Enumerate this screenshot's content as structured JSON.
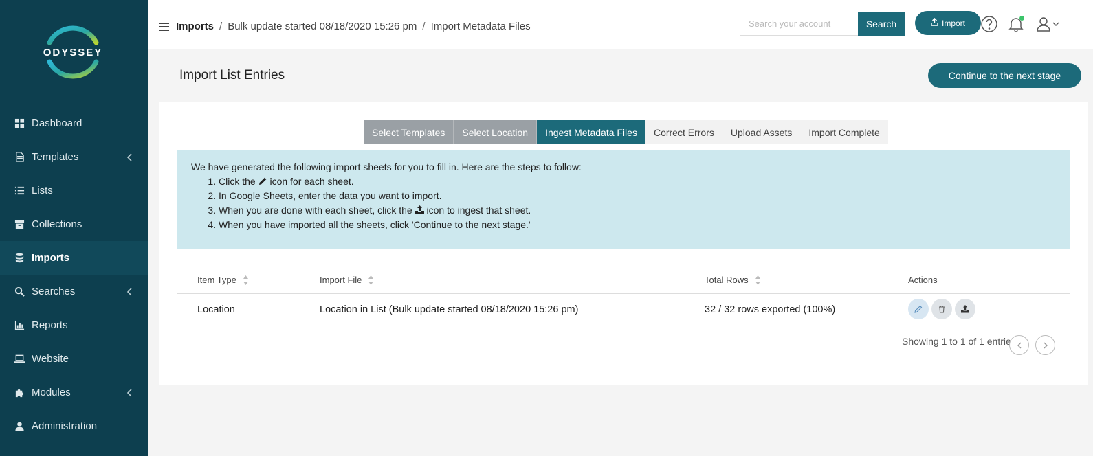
{
  "app": {
    "name": "ODYSSEY"
  },
  "sidebar": {
    "items": [
      {
        "label": "Dashboard",
        "icon": "dashboard-icon"
      },
      {
        "label": "Templates",
        "icon": "document-icon",
        "has_submenu": true
      },
      {
        "label": "Lists",
        "icon": "list-icon"
      },
      {
        "label": "Collections",
        "icon": "archive-icon"
      },
      {
        "label": "Imports",
        "icon": "database-icon",
        "active": true
      },
      {
        "label": "Searches",
        "icon": "search-icon",
        "has_submenu": true
      },
      {
        "label": "Reports",
        "icon": "bar-chart-icon"
      },
      {
        "label": "Website",
        "icon": "laptop-icon"
      },
      {
        "label": "Modules",
        "icon": "puzzle-icon",
        "has_submenu": true
      },
      {
        "label": "Administration",
        "icon": "user-icon"
      }
    ]
  },
  "header": {
    "breadcrumb": [
      "Imports",
      "Bulk update started 08/18/2020 15:26 pm",
      "Import Metadata Files"
    ],
    "search_placeholder": "Search your account",
    "search_label": "Search",
    "import_label": "Import"
  },
  "page": {
    "title": "Import List Entries",
    "continue_label": "Continue to the next stage"
  },
  "steps": [
    {
      "label": "Select Templates",
      "state": "done"
    },
    {
      "label": "Select Location",
      "state": "done"
    },
    {
      "label": "Ingest Metadata Files",
      "state": "current"
    },
    {
      "label": "Correct Errors",
      "state": "todo"
    },
    {
      "label": "Upload Assets",
      "state": "todo"
    },
    {
      "label": "Import Complete",
      "state": "todo"
    }
  ],
  "instructions": {
    "intro": "We have generated the following import sheets for you to fill in. Here are the steps to follow:",
    "step1_pre": "Click the",
    "step1_post": "icon for each sheet.",
    "step2": "In Google Sheets, enter the data you want to import.",
    "step3_pre": "When you are done with each sheet, click the",
    "step3_post": "icon to ingest that sheet.",
    "step4": "When you have imported all the sheets, click 'Continue to the next stage.'"
  },
  "table": {
    "columns": [
      "Item Type",
      "Import File",
      "Total Rows",
      "Actions"
    ],
    "rows": [
      {
        "item_type": "Location",
        "import_file": "Location in List (Bulk update started 08/18/2020 15:26 pm)",
        "total_rows": "32 / 32 rows exported (100%)"
      }
    ]
  },
  "pagination": {
    "summary": "Showing 1 to 1 of 1 entries"
  },
  "colors": {
    "sidebar_bg": "#0d3f4f",
    "accent": "#1c6a7a",
    "info_bg": "#cde8ee"
  }
}
